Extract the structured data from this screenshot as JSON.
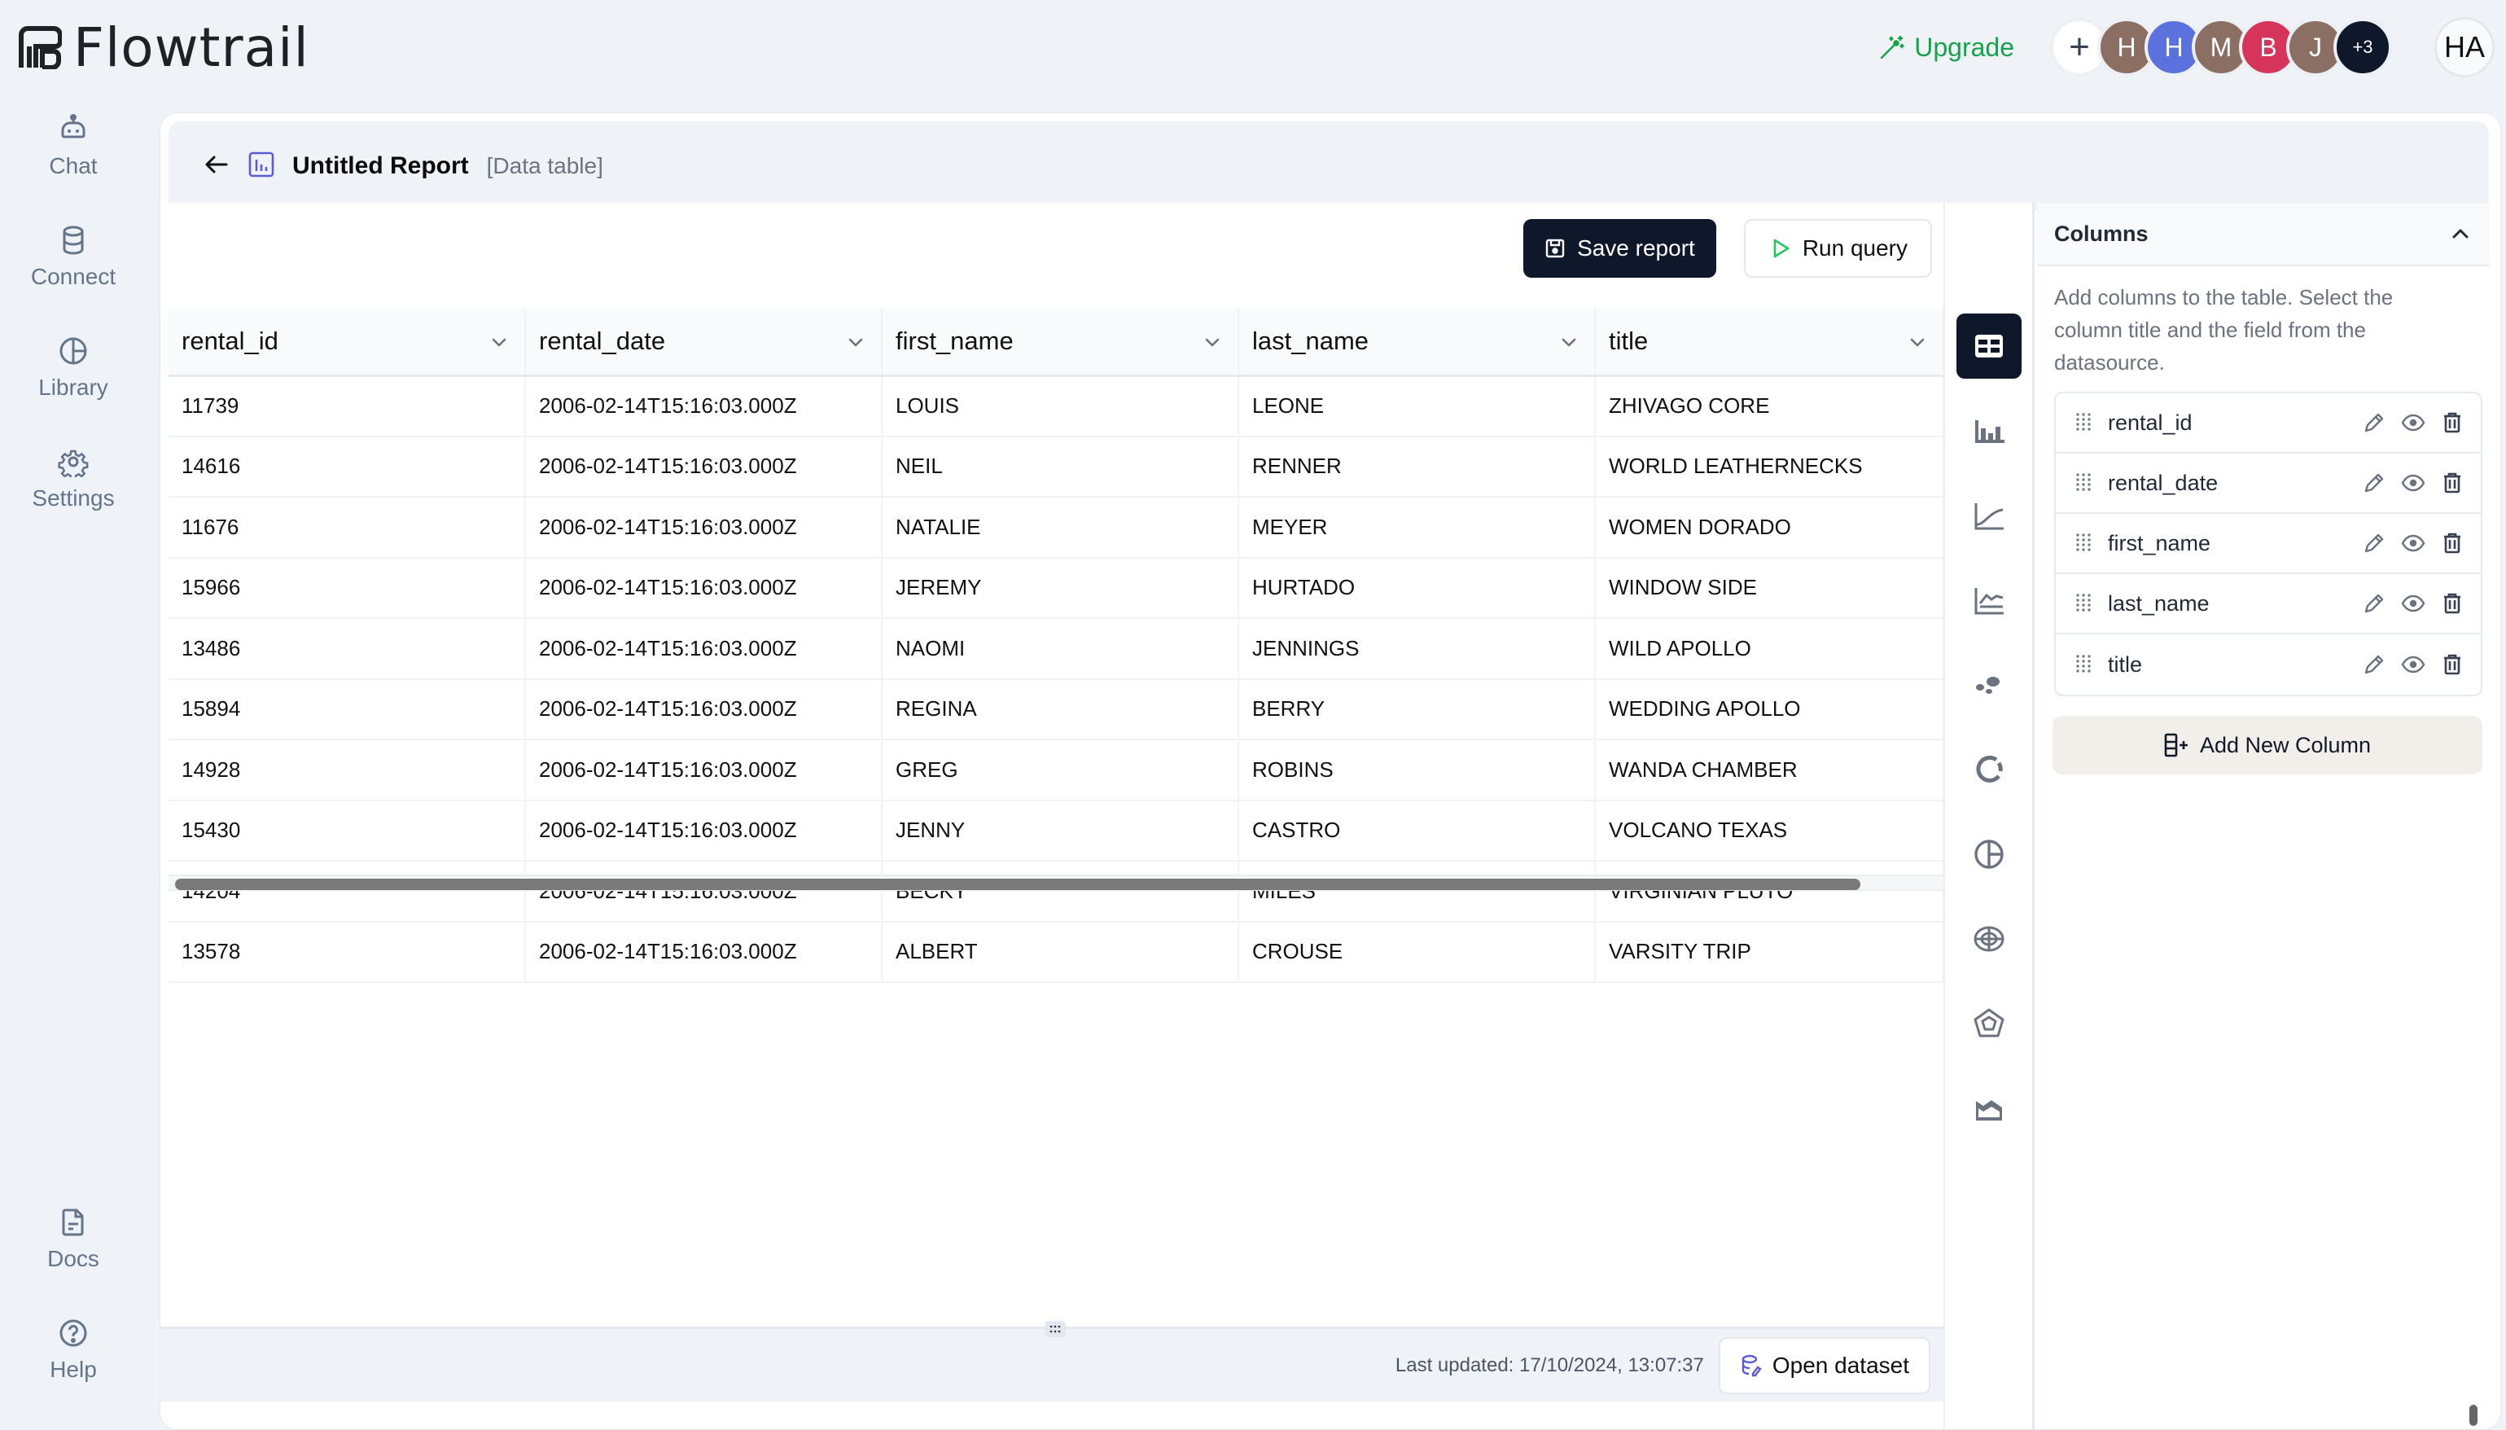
{
  "app": {
    "name": "Flowtrail",
    "upgrade_label": "Upgrade",
    "colors": {
      "accent_green": "#16a34a",
      "dark": "#0f172a",
      "nav_text": "#64748b",
      "report_icon": "#5b5bd6"
    }
  },
  "collaborators": {
    "add_label": "+",
    "avatars": [
      {
        "initial": "H",
        "color": "#8b6f62"
      },
      {
        "initial": "H",
        "color": "#5b72de"
      },
      {
        "initial": "M",
        "color": "#8b6f62"
      },
      {
        "initial": "B",
        "color": "#d6345a"
      },
      {
        "initial": "J",
        "color": "#8b6f62"
      }
    ],
    "more_label": "+3",
    "current_user": "HA"
  },
  "sidebar": {
    "items": [
      {
        "label": "Chat",
        "icon": "robot-icon"
      },
      {
        "label": "Connect",
        "icon": "database-icon"
      },
      {
        "label": "Library",
        "icon": "library-pie-icon"
      },
      {
        "label": "Settings",
        "icon": "gear-icon"
      }
    ],
    "bottom_items": [
      {
        "label": "Docs",
        "icon": "document-icon"
      },
      {
        "label": "Help",
        "icon": "help-circle-icon"
      }
    ]
  },
  "report": {
    "title": "Untitled Report",
    "type_label": "[Data table]"
  },
  "toolbar": {
    "save_label": "Save report",
    "run_label": "Run query"
  },
  "table": {
    "columns": [
      "rental_id",
      "rental_date",
      "first_name",
      "last_name",
      "title"
    ],
    "rows": [
      [
        "11739",
        "2006-02-14T15:16:03.000Z",
        "LOUIS",
        "LEONE",
        "ZHIVAGO CORE"
      ],
      [
        "14616",
        "2006-02-14T15:16:03.000Z",
        "NEIL",
        "RENNER",
        "WORLD LEATHERNECKS"
      ],
      [
        "11676",
        "2006-02-14T15:16:03.000Z",
        "NATALIE",
        "MEYER",
        "WOMEN DORADO"
      ],
      [
        "15966",
        "2006-02-14T15:16:03.000Z",
        "JEREMY",
        "HURTADO",
        "WINDOW SIDE"
      ],
      [
        "13486",
        "2006-02-14T15:16:03.000Z",
        "NAOMI",
        "JENNINGS",
        "WILD APOLLO"
      ],
      [
        "15894",
        "2006-02-14T15:16:03.000Z",
        "REGINA",
        "BERRY",
        "WEDDING APOLLO"
      ],
      [
        "14928",
        "2006-02-14T15:16:03.000Z",
        "GREG",
        "ROBINS",
        "WANDA CHAMBER"
      ],
      [
        "15430",
        "2006-02-14T15:16:03.000Z",
        "JENNY",
        "CASTRO",
        "VOLCANO TEXAS"
      ],
      [
        "14204",
        "2006-02-14T15:16:03.000Z",
        "BECKY",
        "MILES",
        "VIRGINIAN PLUTO"
      ],
      [
        "13578",
        "2006-02-14T15:16:03.000Z",
        "ALBERT",
        "CROUSE",
        "VARSITY TRIP"
      ]
    ]
  },
  "footer": {
    "last_updated": "Last updated: 17/10/2024, 13:07:37",
    "open_dataset_label": "Open dataset"
  },
  "chart_types": {
    "selected": "table",
    "items": [
      "table",
      "bar",
      "line",
      "multi-line",
      "scatter",
      "doughnut",
      "pie",
      "polar",
      "radar",
      "area"
    ]
  },
  "columns_panel": {
    "title": "Columns",
    "description": "Add columns to the table. Select the column title and the field from the datasource.",
    "fields": [
      "rental_id",
      "rental_date",
      "first_name",
      "last_name",
      "title"
    ],
    "add_label": "Add New Column"
  }
}
